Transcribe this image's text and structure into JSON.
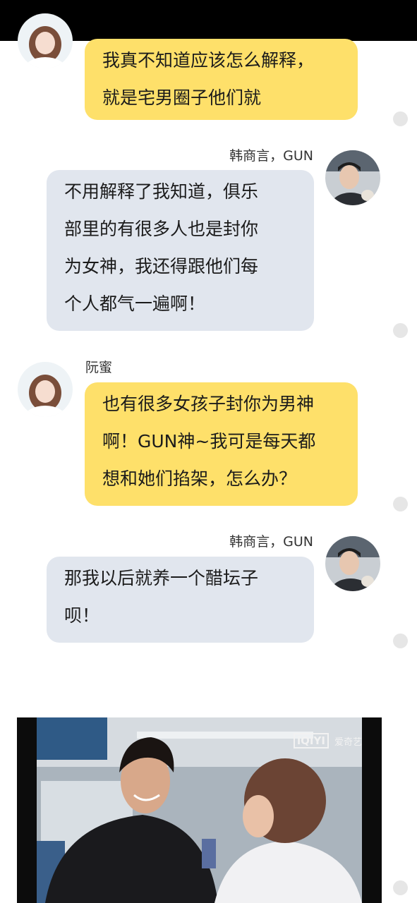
{
  "messages": [
    {
      "side": "left",
      "name": "",
      "lines": [
        "我真不知道应该怎么解释，",
        "就是宅男圈子他们就"
      ]
    },
    {
      "side": "right",
      "name": "韩商言，GUN",
      "lines": [
        "不用解释了我知道，俱乐",
        "部里的有很多人也是封你",
        "为女神，我还得跟他们每",
        "个人都气一遍啊！"
      ]
    },
    {
      "side": "left",
      "name": "阮蜜",
      "lines": [
        "也有很多女孩子封你为男神",
        "啊！GUN神~我可是每天都",
        "想和她们掐架，怎么办？"
      ]
    },
    {
      "side": "right",
      "name": "韩商言，GUN",
      "lines": [
        "那我以后就养一个醋坛子",
        "呗！"
      ]
    }
  ],
  "video": {
    "watermark": "iQIYI",
    "watermark_cn": "爱奇艺"
  },
  "colors": {
    "left_bubble": "#fee06a",
    "right_bubble": "#e1e6ee"
  }
}
